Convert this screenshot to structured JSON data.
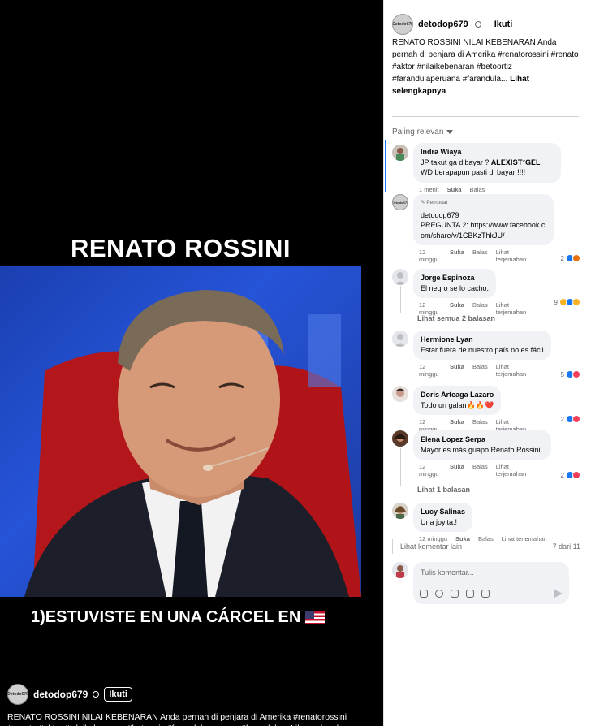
{
  "video": {
    "title": "RENATO ROSSINI",
    "caption": "1)ESTUVISTE EN UNA CÁRCEL EN",
    "author": "detodop679",
    "follow": "Ikuti",
    "description": "RENATO ROSSINI NILAI KEBENARAN Anda pernah di penjara di Amerika #renatorossini #renato #aktor #nilaikebenaran #betoortiz #farandulaperuana #farandula... Lihat selengkapnya"
  },
  "post": {
    "author": "detodop679",
    "follow": "Ikuti",
    "text": "RENATO ROSSINI NILAI KEBENARAN Anda pernah di penjara di Amerika #renatorossini #renato #aktor #nilaikebenaran #betoortiz #farandulaperuana #farandula...",
    "see_more": "Lihat selengkapnya"
  },
  "sort_label": "Paling relevan",
  "comments": [
    {
      "name": "Indra Wiaya",
      "text": "JP takut ga dibayar ? 𝐀𝐋𝐄𝐗𝐈𝐒𝐓*𝐆𝐄𝐋 WD berapapun pasti di bayar !!!!",
      "time": "1 menit",
      "like": "Suka",
      "reply": "Balas"
    },
    {
      "pinned": "Pembuat",
      "name": "detodop679",
      "text": "PREGUNTA 2: https://www.facebook.com/share/v/1CBKzThkJU/",
      "time": "12 minggu",
      "like": "Suka",
      "reply": "Balas",
      "translate": "Lihat terjemahan",
      "count": "2"
    },
    {
      "name": "Jorge Espinoza",
      "text": "El negro se lo cacho.",
      "time": "12 minggu",
      "like": "Suka",
      "reply": "Balas",
      "translate": "Lihat terjemahan",
      "count": "9",
      "replies": "Lihat semua 2 balasan"
    },
    {
      "name": "Hermione Lyan",
      "text": "Estar fuera de nuestro país no es fácil",
      "time": "12 minggu",
      "like": "Suka",
      "reply": "Balas",
      "translate": "Lihat terjemahan",
      "count": "5"
    },
    {
      "name": "Doris Arteaga Lazaro",
      "text": "Todo un galan🔥🔥❤️",
      "time": "12 minggu",
      "like": "Suka",
      "reply": "Balas",
      "translate": "Lihat terjemahan",
      "count": "2"
    },
    {
      "name": "Elena Lopez Serpa",
      "text": "Mayor es más guapo Renato Rossini",
      "time": "12 minggu",
      "like": "Suka",
      "reply": "Balas",
      "translate": "Lihat terjemahan",
      "count": "2",
      "replies": "Lihat 1 balasan"
    },
    {
      "name": "Lucy Salinas",
      "text": "Una joyita.!",
      "time": "12 minggu",
      "like": "Suka",
      "reply": "Balas",
      "translate": "Lihat terjemahan"
    }
  ],
  "more_comments": "Lihat komentar lain",
  "pagination": "7 dari 11",
  "composer_placeholder": "Tulis komentar...",
  "avatar_logo_text": "Detodo679",
  "colors": {
    "accent": "#1877f2",
    "bubble": "#f0f2f5",
    "muted": "#65676b"
  }
}
